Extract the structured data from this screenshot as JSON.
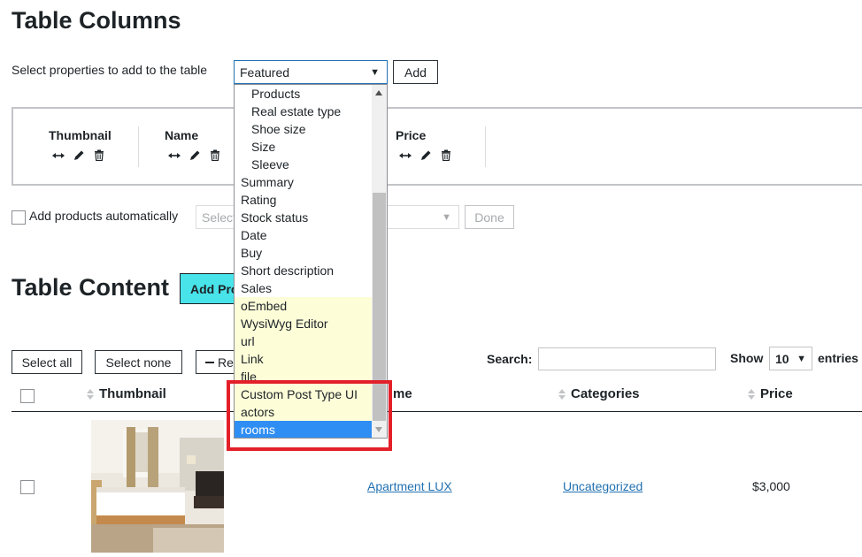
{
  "table_columns": {
    "title": "Table Columns",
    "select_label": "Select properties to add to the table",
    "select_value": "Featured",
    "add_button": "Add",
    "columns": [
      {
        "name": "Thumbnail"
      },
      {
        "name": "Name"
      },
      {
        "name": "Price"
      }
    ],
    "add_products_label": "Add products automatically",
    "add_products_select_placeholder": "Select",
    "done_button": "Done"
  },
  "dropdown": {
    "items": [
      {
        "label": "Products",
        "indent": true,
        "highlight": false
      },
      {
        "label": "Real estate type",
        "indent": true,
        "highlight": false
      },
      {
        "label": "Shoe size",
        "indent": true,
        "highlight": false
      },
      {
        "label": "Size",
        "indent": true,
        "highlight": false
      },
      {
        "label": "Sleeve",
        "indent": true,
        "highlight": false
      },
      {
        "label": "Summary",
        "indent": false,
        "highlight": false
      },
      {
        "label": "Rating",
        "indent": false,
        "highlight": false
      },
      {
        "label": "Stock status",
        "indent": false,
        "highlight": false
      },
      {
        "label": "Date",
        "indent": false,
        "highlight": false
      },
      {
        "label": "Buy",
        "indent": false,
        "highlight": false
      },
      {
        "label": "Short description",
        "indent": false,
        "highlight": false
      },
      {
        "label": "Sales",
        "indent": false,
        "highlight": false
      },
      {
        "label": "oEmbed",
        "indent": false,
        "highlight": true
      },
      {
        "label": "WysiWyg Editor",
        "indent": false,
        "highlight": true
      },
      {
        "label": "url",
        "indent": false,
        "highlight": true
      },
      {
        "label": "Link",
        "indent": false,
        "highlight": true
      },
      {
        "label": "file",
        "indent": false,
        "highlight": true
      },
      {
        "label": "Custom Post Type UI",
        "indent": false,
        "highlight": true
      },
      {
        "label": "actors",
        "indent": false,
        "highlight": true
      },
      {
        "label": "rooms",
        "indent": false,
        "highlight": false,
        "selected": true
      }
    ],
    "highlight_box_color": "#e3202a",
    "selected_color": "#2f8ef4"
  },
  "table_content": {
    "title": "Table Content",
    "add_button": "Add Pro",
    "add_button_color": "#49e3ea",
    "select_all": "Select all",
    "select_none": "Select none",
    "remove_button": "Re",
    "search_label": "Search:",
    "show_label": "Show",
    "entries_value": "10",
    "entries_label": "entries",
    "headers": {
      "thumbnail": "Thumbnail",
      "name": "me",
      "categories": "Categories",
      "price": "Price"
    },
    "rows": [
      {
        "name": "Apartment LUX",
        "category": "Uncategorized",
        "price": "$3,000"
      }
    ]
  }
}
